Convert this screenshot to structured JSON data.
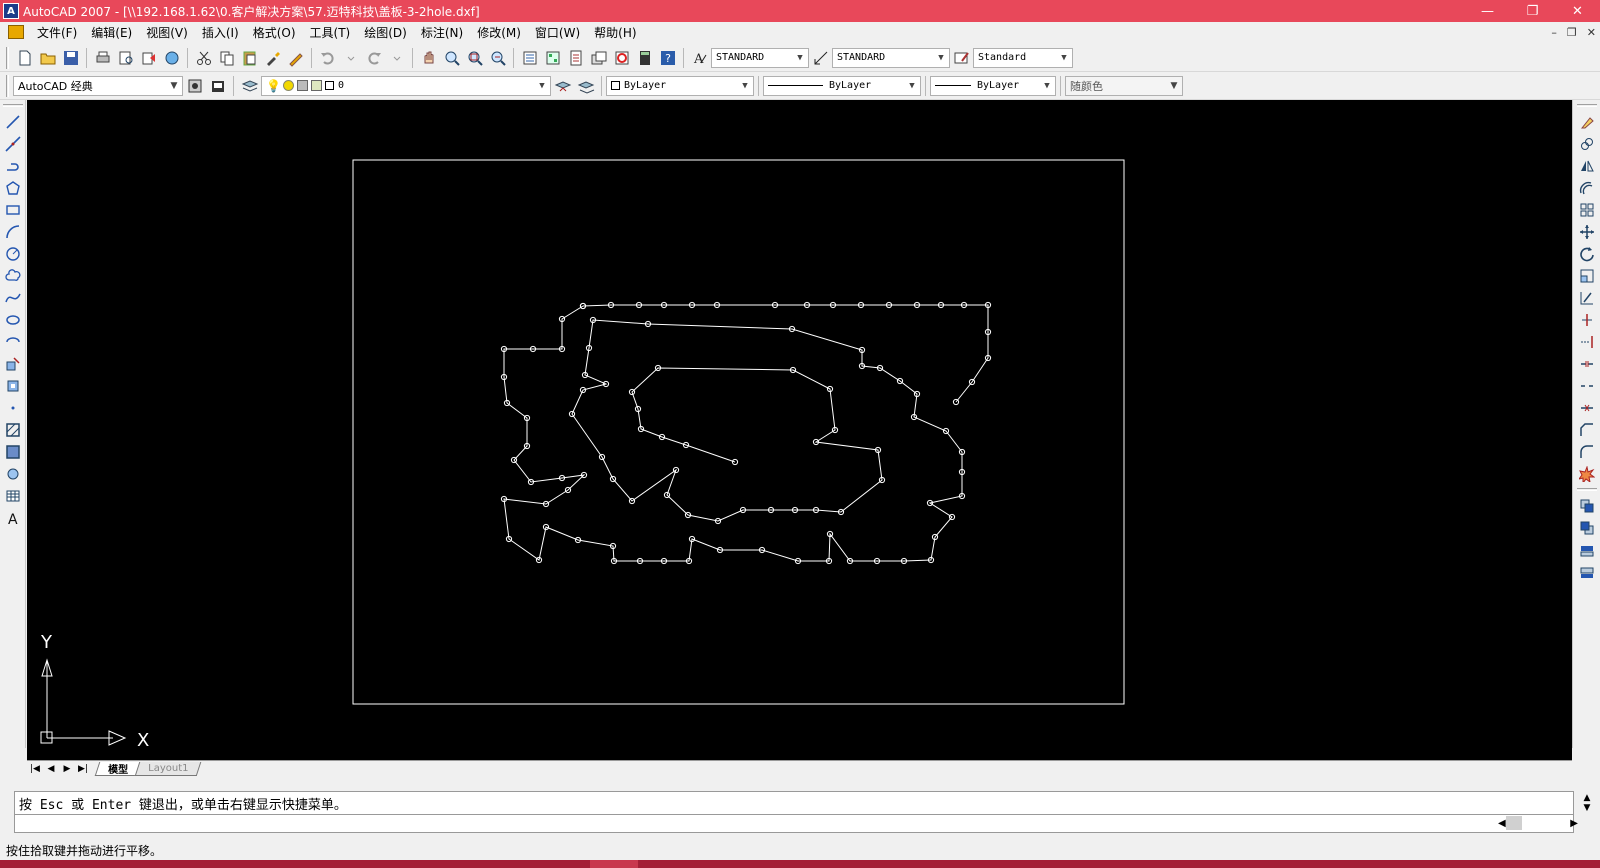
{
  "window": {
    "title": "AutoCAD 2007 - [\\\\192.168.1.62\\0.客户解决方案\\57.迈特科技\\盖板-3-2hole.dxf]",
    "minimize": "—",
    "restore": "❐",
    "close": "✕"
  },
  "menu": {
    "items": [
      "文件(F)",
      "编辑(E)",
      "视图(V)",
      "插入(I)",
      "格式(O)",
      "工具(T)",
      "绘图(D)",
      "标注(N)",
      "修改(M)",
      "窗口(W)",
      "帮助(H)"
    ],
    "doc_min": "–",
    "doc_restore": "❐",
    "doc_close": "✕"
  },
  "toolbar1": {
    "text_style": "STANDARD",
    "dim_style": "STANDARD",
    "table_style": "Standard"
  },
  "toolbar2": {
    "workspace": "AutoCAD 经典",
    "layer": "0",
    "color": "ByLayer",
    "linetype": "ByLayer",
    "lineweight": "ByLayer",
    "plot_style": "随颜色"
  },
  "tabs": {
    "model": "模型",
    "layout1": "Layout1"
  },
  "ucs": {
    "x_label": "X",
    "y_label": "Y"
  },
  "command": {
    "history": "按 Esc 或 Enter 键退出，或单击右键显示快捷菜单。"
  },
  "status": {
    "text": "按住拾取键并拖动进行平移。"
  },
  "colors": {
    "titlebar": "#e8485a",
    "canvas": "#000000",
    "geometry": "#ffffff"
  },
  "icons": {
    "left_toolbar": [
      "line-icon",
      "construction-line-icon",
      "polyline-icon",
      "polygon-icon",
      "rectangle-icon",
      "arc-icon",
      "circle-icon",
      "revision-cloud-icon",
      "spline-icon",
      "ellipse-icon",
      "ellipse-arc-icon",
      "insert-block-icon",
      "make-block-icon",
      "point-icon",
      "hatch-icon",
      "gradient-icon",
      "region-icon",
      "table-icon",
      "multiline-text-icon"
    ],
    "right_toolbar": [
      "erase-icon",
      "copy-icon",
      "mirror-icon",
      "offset-icon",
      "array-icon",
      "move-icon",
      "rotate-icon",
      "scale-icon",
      "stretch-icon",
      "trim-icon",
      "extend-icon",
      "break-at-point-icon",
      "break-icon",
      "join-icon",
      "chamfer-icon",
      "fillet-icon",
      "explode-icon",
      "draworder-front-icon",
      "draworder-back-icon",
      "draworder-above-icon",
      "draworder-under-icon"
    ]
  }
}
